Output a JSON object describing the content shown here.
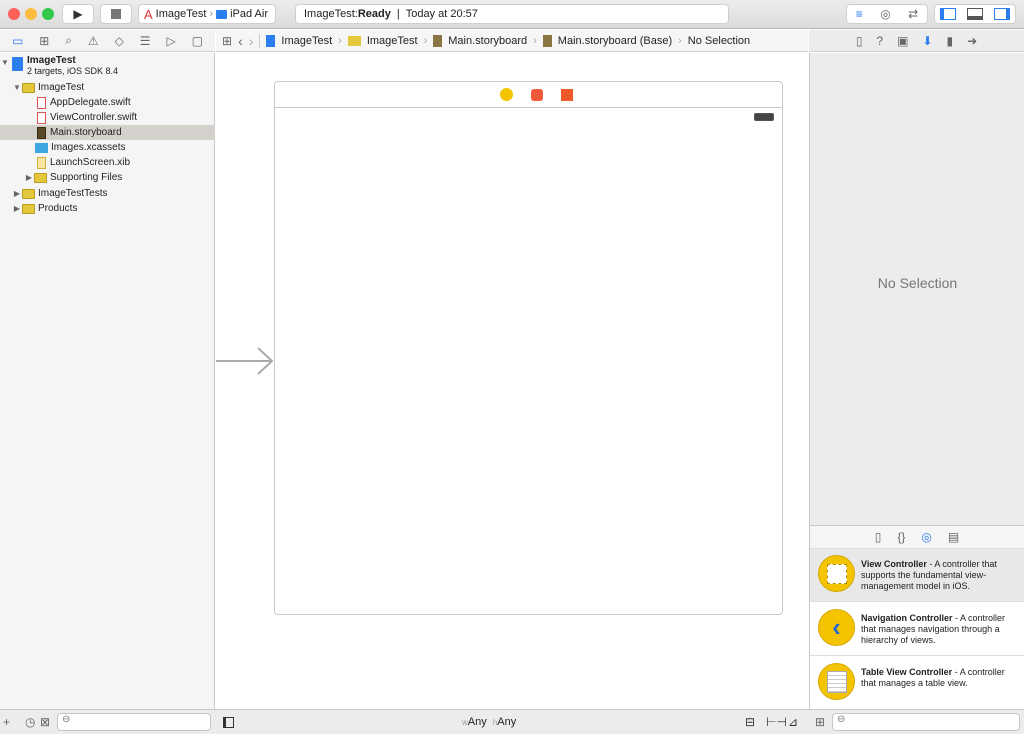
{
  "toolbar": {
    "scheme": "ImageTest",
    "device": "iPad Air",
    "status_prefix": "ImageTest: ",
    "status_bold": "Ready",
    "status_sep": "|",
    "status_time": "Today at 20:57"
  },
  "jumpbar": [
    "ImageTest",
    "ImageTest",
    "Main.storyboard",
    "Main.storyboard (Base)",
    "No Selection"
  ],
  "navigator": {
    "project": "ImageTest",
    "project_sub": "2 targets, iOS SDK 8.4",
    "items": [
      {
        "label": "ImageTest",
        "type": "folder"
      },
      {
        "label": "AppDelegate.swift",
        "type": "swift"
      },
      {
        "label": "ViewController.swift",
        "type": "swift"
      },
      {
        "label": "Main.storyboard",
        "type": "storyboard",
        "selected": true
      },
      {
        "label": "Images.xcassets",
        "type": "assets"
      },
      {
        "label": "LaunchScreen.xib",
        "type": "xib"
      },
      {
        "label": "Supporting Files",
        "type": "folder"
      },
      {
        "label": "ImageTestTests",
        "type": "folder"
      },
      {
        "label": "Products",
        "type": "folder"
      }
    ]
  },
  "inspector": {
    "empty": "No Selection"
  },
  "library": {
    "items": [
      {
        "title": "View Controller",
        "desc": " - A controller that supports the fundamental view-management model in iOS."
      },
      {
        "title": "Navigation Controller",
        "desc": " - A controller that manages navigation through a hierarchy of views."
      },
      {
        "title": "Table View Controller",
        "desc": " - A controller that manages a table view."
      }
    ]
  },
  "canvas": {
    "size_w_prefix": "w",
    "size_w": "Any",
    "size_h_prefix": "h",
    "size_h": "Any"
  },
  "colors": {
    "accent": "#2a7ef0",
    "folder": "#e3c83c",
    "library_circle": "#f5c400"
  }
}
